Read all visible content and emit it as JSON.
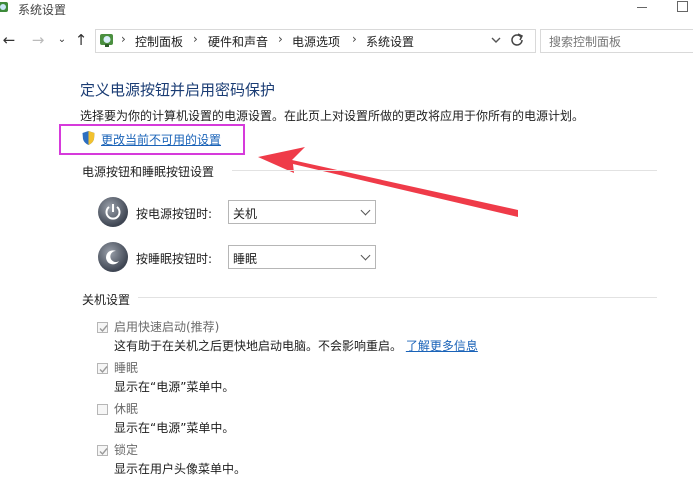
{
  "window": {
    "title": "系统设置",
    "minimize_icon": "minimize-icon",
    "maximize_icon": "maximize-icon"
  },
  "nav": {
    "back_icon": "back-arrow-icon",
    "forward_icon": "forward-arrow-icon",
    "recent_icon": "chevron-down-icon",
    "up_icon": "up-arrow-icon"
  },
  "breadcrumb": {
    "items": [
      "控制面板",
      "硬件和声音",
      "电源选项",
      "系统设置"
    ],
    "separator": "›"
  },
  "search": {
    "placeholder": "搜索控制面板"
  },
  "main": {
    "title": "定义电源按钮并启用密码保护",
    "description": "选择要为你的计算机设置的电源设置。在此页上对设置所做的更改将应用于你所有的电源计划。",
    "change_link": "更改当前不可用的设置",
    "highlight_color": "#d63adb",
    "arrow_color": "#ef3b49"
  },
  "buttons_section": {
    "title": "电源按钮和睡眠按钮设置",
    "power_label": "按电源按钮时:",
    "power_value": "关机",
    "sleep_label": "按睡眠按钮时:",
    "sleep_value": "睡眠"
  },
  "shutdown_section": {
    "title": "关机设置",
    "options": [
      {
        "label": "启用快速启动(推荐)",
        "desc": "这有助于在关机之后更快地启动电脑。不会影响重启。",
        "link": "了解更多信息",
        "checked": true
      },
      {
        "label": "睡眠",
        "desc": "显示在“电源”菜单中。",
        "checked": true
      },
      {
        "label": "休眠",
        "desc": "显示在“电源”菜单中。",
        "checked": false
      },
      {
        "label": "锁定",
        "desc": "显示在用户头像菜单中。",
        "checked": true
      }
    ]
  }
}
